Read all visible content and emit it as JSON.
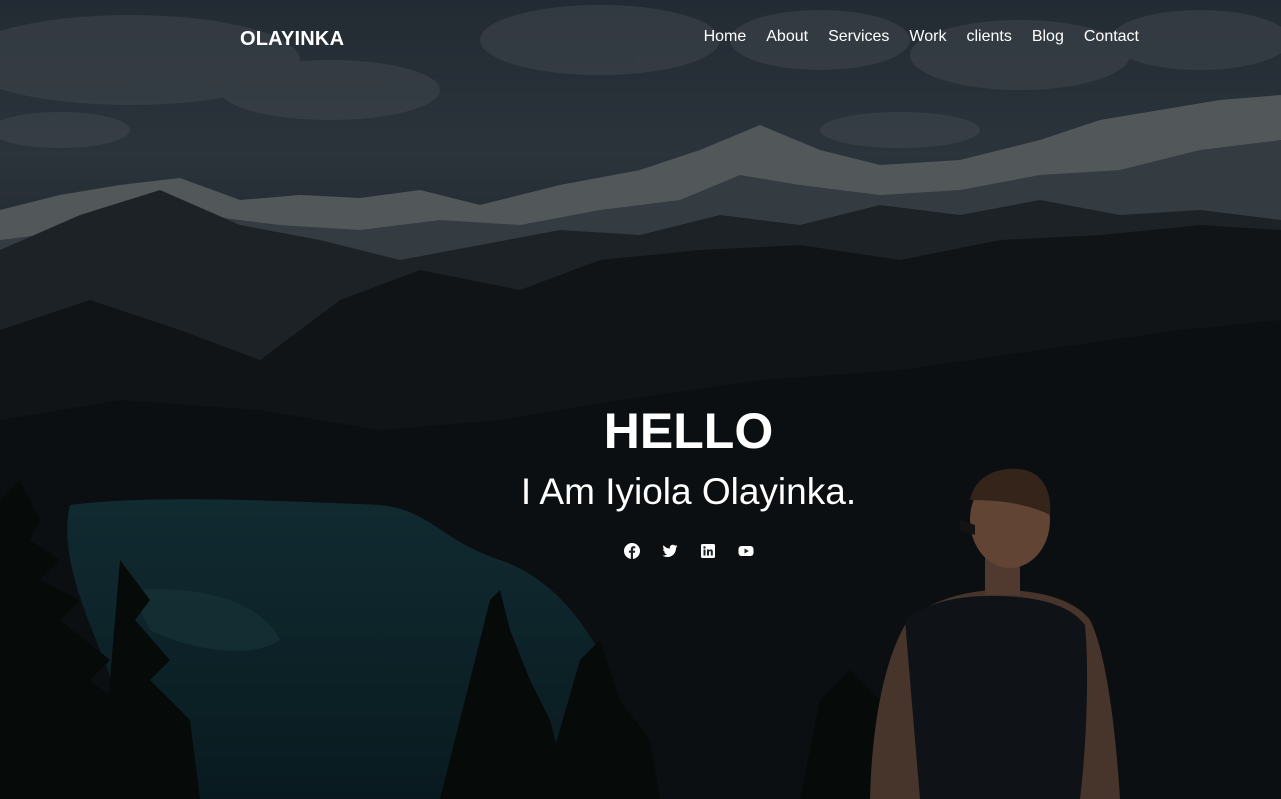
{
  "brand": {
    "logo_text": "OLAYINKA"
  },
  "nav": {
    "items": [
      {
        "label": "Home"
      },
      {
        "label": "About"
      },
      {
        "label": "Services"
      },
      {
        "label": "Work"
      },
      {
        "label": "clients"
      },
      {
        "label": "Blog"
      },
      {
        "label": "Contact"
      }
    ]
  },
  "hero": {
    "greeting": "HELLO",
    "intro": "I Am Iyiola Olayinka.",
    "background": "mountain-lake-landscape-with-hiker",
    "overlay_color": "#000000"
  },
  "social": [
    {
      "icon": "facebook-icon"
    },
    {
      "icon": "twitter-icon"
    },
    {
      "icon": "linkedin-icon"
    },
    {
      "icon": "youtube-icon"
    }
  ],
  "colors": {
    "text": "#ffffff"
  }
}
